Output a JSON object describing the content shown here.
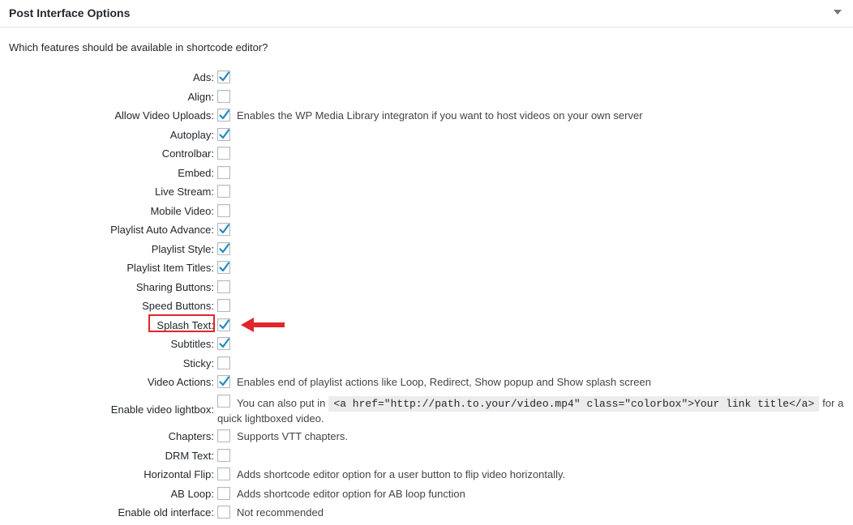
{
  "panel": {
    "title": "Post Interface Options",
    "question": "Which features should be available in shortcode editor?"
  },
  "options": [
    {
      "label": "Ads:",
      "checked": true,
      "desc": ""
    },
    {
      "label": "Align:",
      "checked": false,
      "desc": ""
    },
    {
      "label": "Allow Video Uploads:",
      "checked": true,
      "desc": "Enables the WP Media Library integraton if you want to host videos on your own server"
    },
    {
      "label": "Autoplay:",
      "checked": true,
      "desc": ""
    },
    {
      "label": "Controlbar:",
      "checked": false,
      "desc": ""
    },
    {
      "label": "Embed:",
      "checked": false,
      "desc": ""
    },
    {
      "label": "Live Stream:",
      "checked": false,
      "desc": ""
    },
    {
      "label": "Mobile Video:",
      "checked": false,
      "desc": ""
    },
    {
      "label": "Playlist Auto Advance:",
      "checked": true,
      "desc": ""
    },
    {
      "label": "Playlist Style:",
      "checked": true,
      "desc": ""
    },
    {
      "label": "Playlist Item Titles:",
      "checked": true,
      "desc": ""
    },
    {
      "label": "Sharing Buttons:",
      "checked": false,
      "desc": ""
    },
    {
      "label": "Speed Buttons:",
      "checked": false,
      "desc": ""
    },
    {
      "label": "Splash Text:",
      "checked": true,
      "desc": ""
    },
    {
      "label": "Subtitles:",
      "checked": true,
      "desc": ""
    },
    {
      "label": "Sticky:",
      "checked": false,
      "desc": ""
    },
    {
      "label": "Video Actions:",
      "checked": true,
      "desc": "Enables end of playlist actions like Loop, Redirect, Show popup and Show splash screen"
    }
  ],
  "lightbox": {
    "label": "Enable video lightbox:",
    "checked": false,
    "desc_before": "You can also put in",
    "code": "<a href=\"http://path.to.your/video.mp4\" class=\"colorbox\">Your link title</a>",
    "desc_after": "for a",
    "desc_line2": "quick lightboxed video."
  },
  "options_after": [
    {
      "label": "Chapters:",
      "checked": false,
      "desc": "Supports VTT chapters."
    },
    {
      "label": "DRM Text:",
      "checked": false,
      "desc": ""
    },
    {
      "label": "Horizontal Flip:",
      "checked": false,
      "desc": "Adds shortcode editor option for a user button to flip video horizontally."
    },
    {
      "label": "AB Loop:",
      "checked": false,
      "desc": "Adds shortcode editor option for AB loop function"
    },
    {
      "label": "Enable old interface:",
      "checked": false,
      "desc": "Not recommended"
    }
  ],
  "colors": {
    "checkmark": "#1e8cbe",
    "highlight": "#e0262b"
  }
}
